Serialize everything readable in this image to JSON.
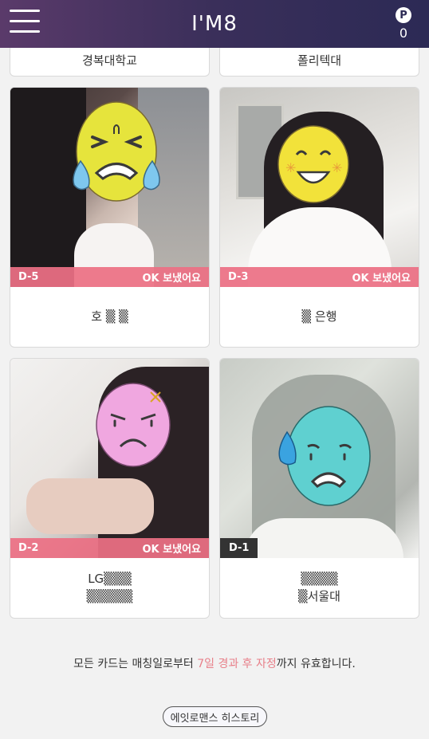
{
  "header": {
    "logo": "I'M8",
    "points_icon": "P",
    "points_count": "0",
    "menu_icon": "hamburger-icon"
  },
  "top_cards": [
    {
      "name": "경복대학교"
    },
    {
      "name": "폴리텍대"
    }
  ],
  "cards": [
    {
      "d_label": "D-5",
      "status": "OK 보냈어요",
      "name_lines": [
        "호 ▒ ▒"
      ],
      "emoji": "crying-face-icon",
      "face_color": "#e8e64a"
    },
    {
      "d_label": "D-3",
      "status": "OK 보냈어요",
      "name_lines": [
        "▒ 은행"
      ],
      "emoji": "smiling-face-icon",
      "face_color": "#f2e23a"
    },
    {
      "d_label": "D-2",
      "status": "OK 보냈어요",
      "name_lines": [
        "LG▒▒▒",
        "▒▒▒▒▒"
      ],
      "emoji": "angry-face-icon",
      "face_color": "#f0a7e0"
    },
    {
      "d_label": "D-1",
      "status": "",
      "name_lines": [
        "▒▒▒▒",
        "▒서울대"
      ],
      "emoji": "sweating-face-icon",
      "face_color": "#5fd0d0"
    }
  ],
  "footer": {
    "note_before": "모든 카드는 매칭일로부터 ",
    "note_highlight": "7일 경과 후 자정",
    "note_after": "까지 유효합니다.",
    "history_button": "에잇로맨스 히스토리"
  },
  "colors": {
    "header_start": "#5a3a6a",
    "header_end": "#2c2a55",
    "accent_pink": "#ec7084",
    "highlight": "#e8808a"
  }
}
